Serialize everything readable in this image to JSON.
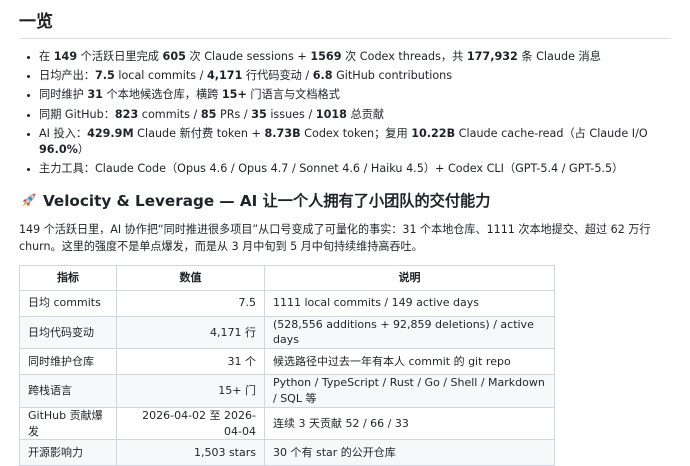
{
  "heading": "一览",
  "bullets": [
    {
      "parts": [
        {
          "t": "在 ",
          "b": false
        },
        {
          "t": "149",
          "b": true
        },
        {
          "t": " 个活跃日里完成 ",
          "b": false
        },
        {
          "t": "605",
          "b": true
        },
        {
          "t": " 次 Claude sessions + ",
          "b": false
        },
        {
          "t": "1569",
          "b": true
        },
        {
          "t": " 次 Codex threads，共 ",
          "b": false
        },
        {
          "t": "177,932",
          "b": true
        },
        {
          "t": " 条 Claude 消息",
          "b": false
        }
      ]
    },
    {
      "parts": [
        {
          "t": "日均产出：",
          "b": false
        },
        {
          "t": "7.5",
          "b": true
        },
        {
          "t": " local commits / ",
          "b": false
        },
        {
          "t": "4,171",
          "b": true
        },
        {
          "t": " 行代码变动 / ",
          "b": false
        },
        {
          "t": "6.8",
          "b": true
        },
        {
          "t": " GitHub contributions",
          "b": false
        }
      ]
    },
    {
      "parts": [
        {
          "t": "同时维护 ",
          "b": false
        },
        {
          "t": "31",
          "b": true
        },
        {
          "t": " 个本地候选仓库，横跨 ",
          "b": false
        },
        {
          "t": "15+",
          "b": true
        },
        {
          "t": " 门语言与文档格式",
          "b": false
        }
      ]
    },
    {
      "parts": [
        {
          "t": "同期 GitHub：",
          "b": false
        },
        {
          "t": "823",
          "b": true
        },
        {
          "t": " commits / ",
          "b": false
        },
        {
          "t": "85",
          "b": true
        },
        {
          "t": " PRs / ",
          "b": false
        },
        {
          "t": "35",
          "b": true
        },
        {
          "t": " issues / ",
          "b": false
        },
        {
          "t": "1018",
          "b": true
        },
        {
          "t": " 总贡献",
          "b": false
        }
      ]
    },
    {
      "parts": [
        {
          "t": "AI 投入：",
          "b": false
        },
        {
          "t": "429.9M",
          "b": true
        },
        {
          "t": " Claude 新付费 token + ",
          "b": false
        },
        {
          "t": "8.73B",
          "b": true
        },
        {
          "t": " Codex token；复用 ",
          "b": false
        },
        {
          "t": "10.22B",
          "b": true
        },
        {
          "t": " Claude cache-read（占 Claude I/O ",
          "b": false
        },
        {
          "t": "96.0%",
          "b": true
        },
        {
          "t": "）",
          "b": false
        }
      ]
    },
    {
      "parts": [
        {
          "t": "主力工具：Claude Code（Opus 4.6 / Opus 4.7 / Sonnet 4.6 / Haiku 4.5）+ Codex CLI（GPT-5.4 / GPT-5.5）",
          "b": false
        }
      ]
    }
  ],
  "section": {
    "icon": "rocket-icon",
    "title": "Velocity & Leverage — AI 让一个人拥有了小团队的交付能力",
    "intro": "149 个活跃日里，AI 协作把“同时推进很多项目”从口号变成了可量化的事实：31 个本地仓库、1111 次本地提交、超过 62 万行 churn。这里的强度不是单点爆发，而是从 3 月中旬到 5 月中旬持续维持高吞吐。"
  },
  "table": {
    "headers": [
      "指标",
      "数值",
      "说明"
    ],
    "rows": [
      [
        "日均 commits",
        "7.5",
        "1111 local commits / 149 active days"
      ],
      [
        "日均代码变动",
        "4,171 行",
        "(528,556 additions + 92,859 deletions) / active days"
      ],
      [
        "同时维护仓库",
        "31 个",
        "候选路径中过去一年有本人 commit 的 git repo"
      ],
      [
        "跨栈语言",
        "15+ 门",
        "Python / TypeScript / Rust / Go / Shell / Markdown / SQL 等"
      ],
      [
        "GitHub 贡献爆发",
        "2026-04-02 至 2026-04-04",
        "连续 3 天贡献 52 / 66 / 33"
      ],
      [
        "开源影响力",
        "1,503 stars",
        "30 个有 star 的公开仓库"
      ]
    ]
  }
}
